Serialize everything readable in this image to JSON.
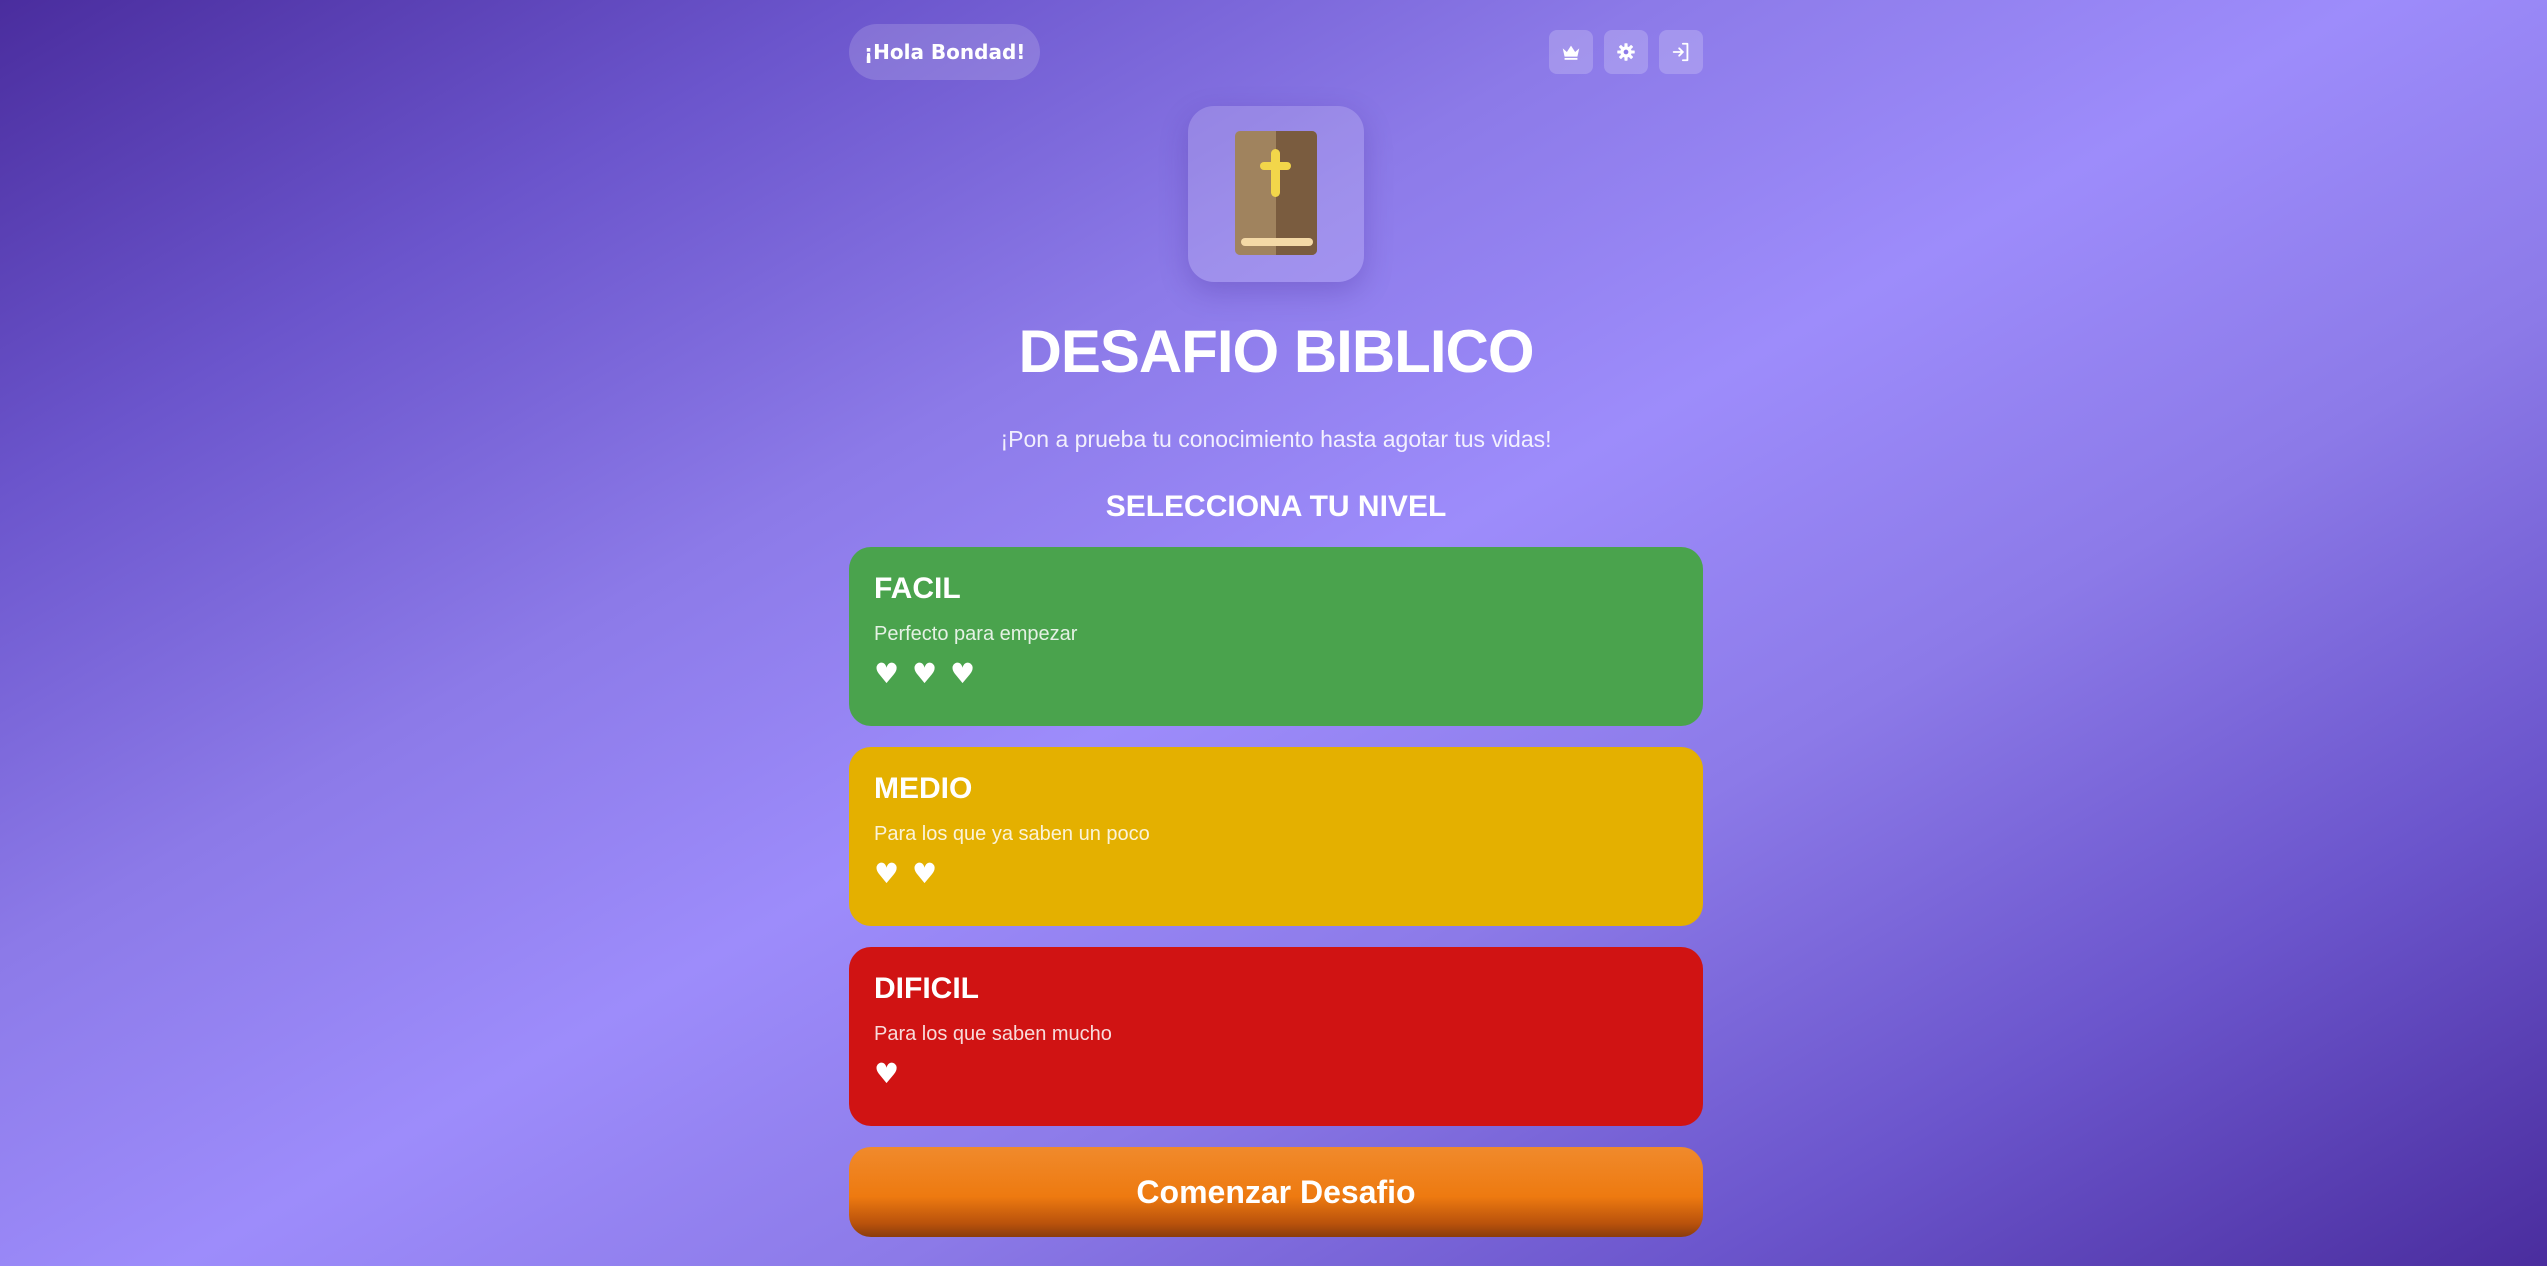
{
  "header": {
    "greeting": "¡Hola Bondad!",
    "icons": [
      "crown-icon",
      "gear-icon",
      "sign-in-icon"
    ]
  },
  "logo": {
    "icon": "bible-icon"
  },
  "title": "DESAFIO BIBLICO",
  "subtitle": "¡Pon a prueba tu conocimiento hasta agotar tus vidas!",
  "section_heading": "SELECCIONA TU NIVEL",
  "levels": [
    {
      "name": "FACIL",
      "description": "Perfecto para empezar",
      "hearts": "♥ ♥ ♥",
      "lives": 3,
      "color": "#4aa34d"
    },
    {
      "name": "MEDIO",
      "description": "Para los que ya saben un poco",
      "hearts": "♥ ♥",
      "lives": 2,
      "color": "#e4b000"
    },
    {
      "name": "DIFICIL",
      "description": "Para los que saben mucho",
      "hearts": "♥",
      "lives": 1,
      "color": "#d01313"
    }
  ],
  "start_button": "Comenzar Desafio",
  "colors": {
    "background_dark": "#4a2d9e",
    "background_light": "#9d8cfb",
    "start_button": "#ee7a10",
    "icon_cross": "#f2d64a"
  }
}
